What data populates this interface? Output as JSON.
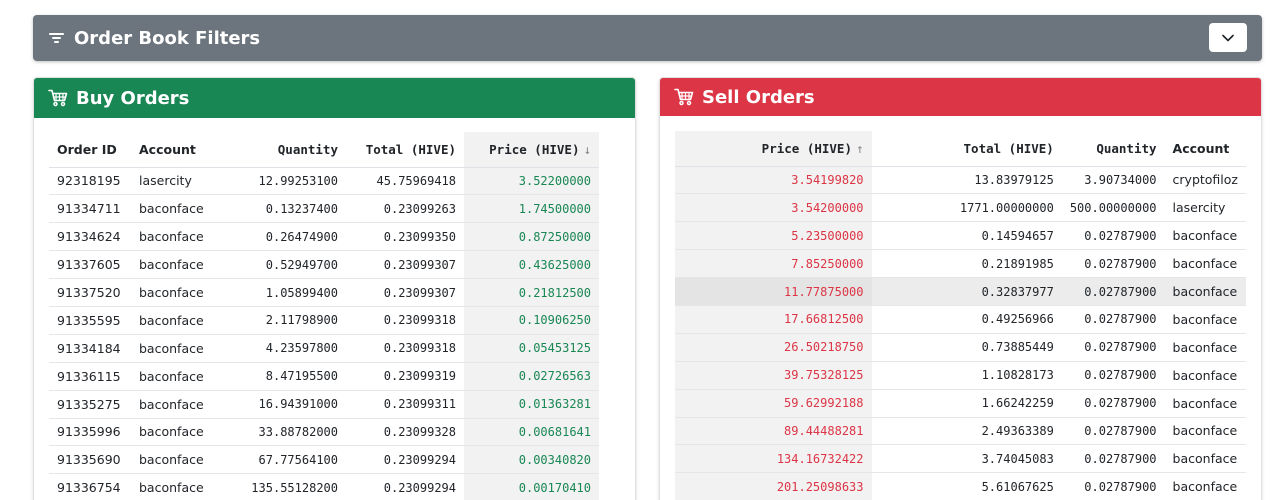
{
  "filters": {
    "title": "Order Book Filters",
    "icon": "filter-icon",
    "toggle_icon": "chevron-down-icon"
  },
  "buy": {
    "title": "Buy Orders",
    "icon": "cart-icon",
    "color": "#198754",
    "columns": {
      "order_id": "Order ID",
      "account": "Account",
      "quantity": "Quantity",
      "total": "Total (HIVE)",
      "price": "Price (HIVE)",
      "price_sort": "↓"
    },
    "rows": [
      {
        "order_id": "92318195",
        "account": "lasercity",
        "quantity": "12.99253100",
        "total": "45.75969418",
        "price": "3.52200000"
      },
      {
        "order_id": "91334711",
        "account": "baconface",
        "quantity": "0.13237400",
        "total": "0.23099263",
        "price": "1.74500000"
      },
      {
        "order_id": "91334624",
        "account": "baconface",
        "quantity": "0.26474900",
        "total": "0.23099350",
        "price": "0.87250000"
      },
      {
        "order_id": "91337605",
        "account": "baconface",
        "quantity": "0.52949700",
        "total": "0.23099307",
        "price": "0.43625000"
      },
      {
        "order_id": "91337520",
        "account": "baconface",
        "quantity": "1.05899400",
        "total": "0.23099307",
        "price": "0.21812500"
      },
      {
        "order_id": "91335595",
        "account": "baconface",
        "quantity": "2.11798900",
        "total": "0.23099318",
        "price": "0.10906250"
      },
      {
        "order_id": "91334184",
        "account": "baconface",
        "quantity": "4.23597800",
        "total": "0.23099318",
        "price": "0.05453125"
      },
      {
        "order_id": "91336115",
        "account": "baconface",
        "quantity": "8.47195500",
        "total": "0.23099319",
        "price": "0.02726563"
      },
      {
        "order_id": "91335275",
        "account": "baconface",
        "quantity": "16.94391000",
        "total": "0.23099311",
        "price": "0.01363281"
      },
      {
        "order_id": "91335996",
        "account": "baconface",
        "quantity": "33.88782000",
        "total": "0.23099328",
        "price": "0.00681641"
      },
      {
        "order_id": "91335690",
        "account": "baconface",
        "quantity": "67.77564100",
        "total": "0.23099294",
        "price": "0.00340820"
      },
      {
        "order_id": "91336754",
        "account": "baconface",
        "quantity": "135.55128200",
        "total": "0.23099294",
        "price": "0.00170410"
      }
    ]
  },
  "sell": {
    "title": "Sell Orders",
    "icon": "cart-icon",
    "color": "#dc3545",
    "columns": {
      "price": "Price (HIVE)",
      "price_sort": "↑",
      "total": "Total (HIVE)",
      "quantity": "Quantity",
      "account": "Account"
    },
    "rows": [
      {
        "price": "3.54199820",
        "total": "13.83979125",
        "quantity": "3.90734000",
        "account": "cryptofiloz"
      },
      {
        "price": "3.54200000",
        "total": "1771.00000000",
        "quantity": "500.00000000",
        "account": "lasercity"
      },
      {
        "price": "5.23500000",
        "total": "0.14594657",
        "quantity": "0.02787900",
        "account": "baconface"
      },
      {
        "price": "7.85250000",
        "total": "0.21891985",
        "quantity": "0.02787900",
        "account": "baconface"
      },
      {
        "price": "11.77875000",
        "total": "0.32837977",
        "quantity": "0.02787900",
        "account": "baconface"
      },
      {
        "price": "17.66812500",
        "total": "0.49256966",
        "quantity": "0.02787900",
        "account": "baconface"
      },
      {
        "price": "26.50218750",
        "total": "0.73885449",
        "quantity": "0.02787900",
        "account": "baconface"
      },
      {
        "price": "39.75328125",
        "total": "1.10828173",
        "quantity": "0.02787900",
        "account": "baconface"
      },
      {
        "price": "59.62992188",
        "total": "1.66242259",
        "quantity": "0.02787900",
        "account": "baconface"
      },
      {
        "price": "89.44488281",
        "total": "2.49363389",
        "quantity": "0.02787900",
        "account": "baconface"
      },
      {
        "price": "134.16732422",
        "total": "3.74045083",
        "quantity": "0.02787900",
        "account": "baconface"
      },
      {
        "price": "201.25098633",
        "total": "5.61067625",
        "quantity": "0.02787900",
        "account": "baconface"
      }
    ]
  }
}
